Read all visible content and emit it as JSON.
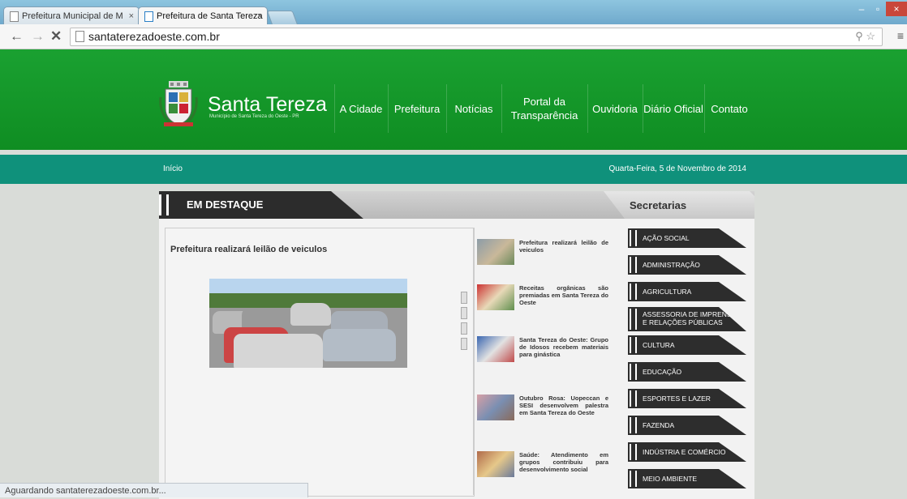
{
  "browser": {
    "tabs": [
      {
        "label": "Prefeitura Municipal de M"
      },
      {
        "label": "Prefeitura de Santa Tereza"
      }
    ],
    "tab_close": "×",
    "url": "santaterezadoeste.com.br",
    "status": "Aguardando santaterezadoeste.com.br...",
    "window_controls": {
      "minimize": "–",
      "maximize": "▫",
      "close": "×"
    }
  },
  "site": {
    "title": "Santa Tereza",
    "subtitle": "Município de Santa Tereza do Oeste - PR",
    "menu": [
      {
        "label": "A Cidade"
      },
      {
        "label": "Prefeitura"
      },
      {
        "label": "Notícias"
      },
      {
        "label": "Portal da Transparência"
      },
      {
        "label": "Ouvidoria"
      },
      {
        "label": "Diário Oficial"
      },
      {
        "label": "Contato"
      }
    ],
    "breadcrumb": "Início",
    "date": "Quarta-Feira, 5 de Novembro de 2014"
  },
  "featured": {
    "tab_label": "EM DESTAQUE",
    "title": "Prefeitura realizará leilão de veiculos"
  },
  "news": [
    {
      "text": "Prefeitura realizará leilão de veiculos"
    },
    {
      "text": "Receitas orgânicas são premiadas em Santa Tereza do Oeste"
    },
    {
      "text": "Santa Tereza do Oeste: Grupo de Idosos recebem materiais para ginástica"
    },
    {
      "text": "Outubro Rosa: Uopeccan e SESI desenvolvem palestra em Santa Tereza do Oeste"
    },
    {
      "text": "Saúde: Atendimento em grupos contribuiu para desenvolvimento social"
    }
  ],
  "secretarias": {
    "tab_label": "Secretarias",
    "items": [
      {
        "label": "AÇÃO SOCIAL"
      },
      {
        "label": "ADMINISTRAÇÃO"
      },
      {
        "label": "AGRICULTURA"
      },
      {
        "label": "ASSESSORIA DE IMPRENSA",
        "label2": "E RELAÇÕES PÚBLICAS"
      },
      {
        "label": "CULTURA"
      },
      {
        "label": "EDUCAÇÃO"
      },
      {
        "label": "ESPORTES E LAZER"
      },
      {
        "label": "FAZENDA"
      },
      {
        "label": "INDÚSTRIA E COMÉRCIO"
      },
      {
        "label": "MEIO AMBIENTE"
      }
    ]
  },
  "colors": {
    "header_green": "#139a2a",
    "bar_teal": "#0f917b",
    "dark_tab": "#2c2c2c"
  }
}
